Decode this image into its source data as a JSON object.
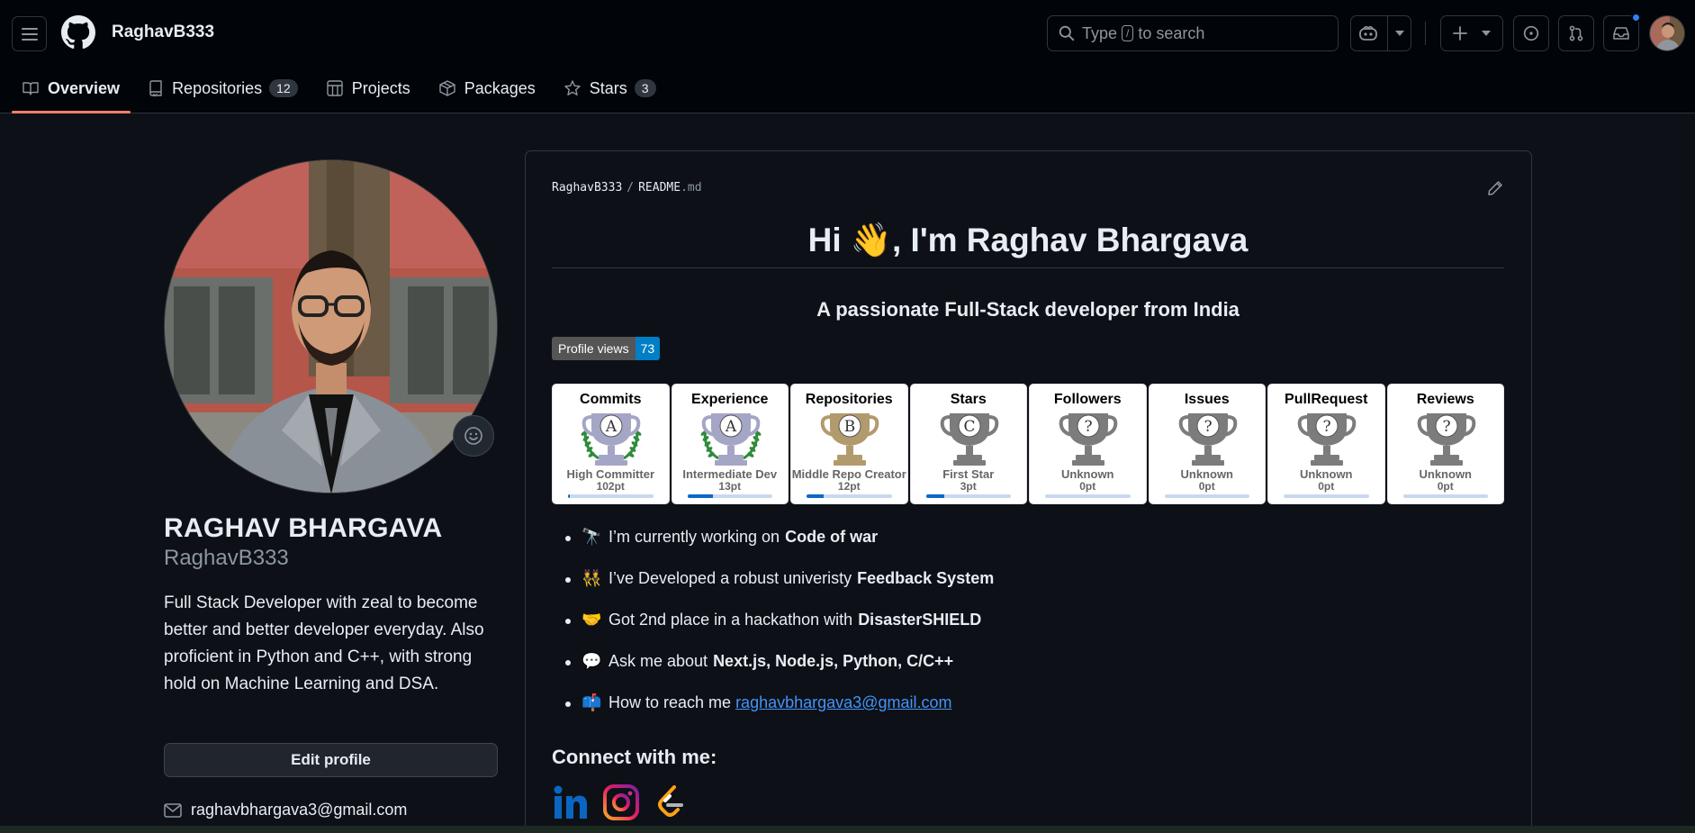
{
  "header": {
    "username": "RaghavB333",
    "search_placeholder_pre": "Type",
    "search_placeholder_key": "/",
    "search_placeholder_post": "to search"
  },
  "tabs": [
    {
      "label": "Overview",
      "active": true
    },
    {
      "label": "Repositories",
      "count": "12"
    },
    {
      "label": "Projects"
    },
    {
      "label": "Packages"
    },
    {
      "label": "Stars",
      "count": "3"
    }
  ],
  "profile": {
    "fullname": "RAGHAV BHARGAVA",
    "login": "RaghavB333",
    "bio": "Full Stack Developer with zeal to become better and better developer everyday. Also proficient in Python and C++, with strong hold on Machine Learning and DSA.",
    "edit_label": "Edit profile",
    "email": "raghavbhargava3@gmail.com"
  },
  "readme": {
    "path_owner": "RaghavB333",
    "path_sep": "/",
    "path_file": "README",
    "path_ext": ".md",
    "title": "Hi 👋, I'm Raghav Bhargava",
    "subtitle": "A passionate Full-Stack developer from India",
    "badge_label": "Profile views",
    "badge_value": "73",
    "trophies": [
      {
        "title": "Commits",
        "rank": "A",
        "name": "High Committer",
        "points": "102pt",
        "progress": 0.02,
        "cup": "#a5a5c6",
        "laurel": true
      },
      {
        "title": "Experience",
        "rank": "A",
        "name": "Intermediate Dev",
        "points": "13pt",
        "progress": 0.3,
        "cup": "#a5a5c6",
        "laurel": true
      },
      {
        "title": "Repositories",
        "rank": "B",
        "name": "Middle Repo Creator",
        "points": "12pt",
        "progress": 0.2,
        "cup": "#b19a6c",
        "laurel": false
      },
      {
        "title": "Stars",
        "rank": "C",
        "name": "First Star",
        "points": "3pt",
        "progress": 0.22,
        "cup": "#7c7c7c",
        "laurel": false
      },
      {
        "title": "Followers",
        "rank": "?",
        "name": "Unknown",
        "points": "0pt",
        "progress": 0,
        "cup": "#7c7c7c",
        "laurel": false
      },
      {
        "title": "Issues",
        "rank": "?",
        "name": "Unknown",
        "points": "0pt",
        "progress": 0,
        "cup": "#7c7c7c",
        "laurel": false
      },
      {
        "title": "PullRequest",
        "rank": "?",
        "name": "Unknown",
        "points": "0pt",
        "progress": 0,
        "cup": "#7c7c7c",
        "laurel": false
      },
      {
        "title": "Reviews",
        "rank": "?",
        "name": "Unknown",
        "points": "0pt",
        "progress": 0,
        "cup": "#7c7c7c",
        "laurel": false
      }
    ],
    "items": [
      {
        "emoji": "🔭",
        "text": "I’m currently working on",
        "bold": "Code of war"
      },
      {
        "emoji": "👯",
        "text": "I’ve Developed a robust univeristy",
        "bold": "Feedback System"
      },
      {
        "emoji": "🤝",
        "text": "Got 2nd place in a hackathon with",
        "bold": "DisasterSHIELD"
      },
      {
        "emoji": "💬",
        "text": "Ask me about",
        "bold": "Next.js, Node.js, Python, C/C++"
      },
      {
        "emoji": "📫",
        "text": "How to reach me",
        "link": "raghavbhargava3@gmail.com"
      }
    ],
    "connect_heading": "Connect with me:"
  },
  "colors": {
    "bg": "#0d1117",
    "header_bg": "#010409",
    "border": "#30363d",
    "accent_underline": "#f78166",
    "link": "#4493f8",
    "badge_blue": "#007ec6"
  }
}
